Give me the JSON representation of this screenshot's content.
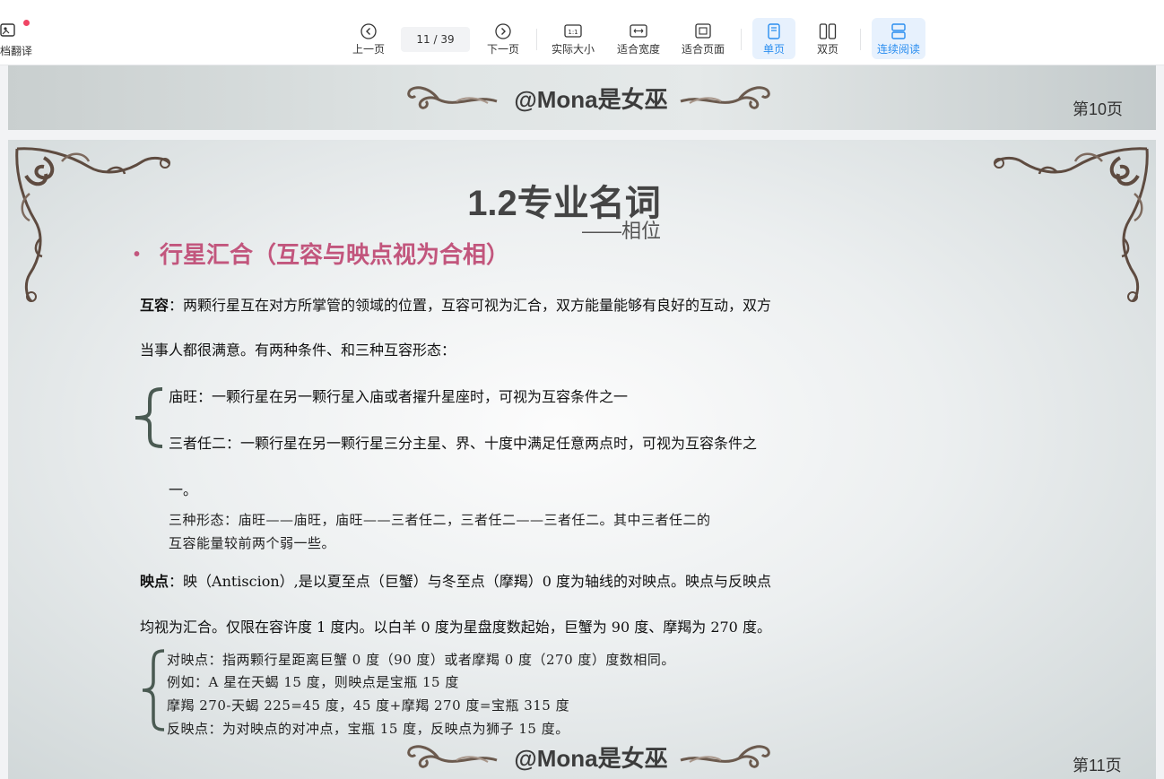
{
  "toolbar": {
    "left_label": "档翻译",
    "prev_label": "上一页",
    "page_indicator": "11 / 39",
    "next_label": "下一页",
    "actual_size_label": "实际大小",
    "fit_width_label": "适合宽度",
    "fit_page_label": "适合页面",
    "single_page_label": "单页",
    "double_page_label": "双页",
    "continuous_label": "连续阅读",
    "actual_size_icon_text": "1:1",
    "accent_color": "#2a8ef0"
  },
  "prev_page": {
    "watermark": "@Mona是女巫",
    "page_number": "第10页"
  },
  "page": {
    "title": "1.2专业名词",
    "subtitle": "——相位",
    "bullet_heading": "行星汇合（互容与映点视为合相）",
    "bullet_color": "#c2567d",
    "mutual_term": "互容",
    "mutual_def_1": "：两颗行星互在对方所掌管的领域的位置，互容可视为汇合，双方能量能够有良好的互动，双方",
    "mutual_def_2": "当事人都很满意。有两种条件、和三种互容形态：",
    "cond_1": "庙旺：一颗行星在另一颗行星入庙或者擢升星座时，可视为互容条件之一",
    "cond_2a": "三者任二：一颗行星在另一颗行星三分主星、界、十度中满足任意两点时，可视为互容条件之",
    "cond_2b": "一。",
    "forms_1": "三种形态：庙旺——庙旺，庙旺——三者任二，三者任二——三者任二。其中三者任二的",
    "forms_2": "互容能量较前两个弱一些。",
    "antiscion_term": "映点",
    "antiscion_def_1": "：映（Antiscion）,是以夏至点（巨蟹）与冬至点（摩羯）0 度为轴线的对映点。映点与反映点",
    "antiscion_def_2": "均视为汇合。仅限在容许度 1 度内。以白羊 0 度为星盘度数起始，巨蟹为 90 度、摩羯为 270 度。",
    "anti_1": "对映点：指两颗行星距离巨蟹 0 度（90 度）或者摩羯 0 度（270 度）度数相同。",
    "anti_2": "例如：A 星在天蝎 15 度，则映点是宝瓶 15 度",
    "anti_3": "摩羯 270-天蝎 225=45 度，45 度+摩羯 270 度=宝瓶 315 度",
    "anti_4": "反映点：为对映点的对冲点，宝瓶 15 度，反映点为狮子 15 度。",
    "watermark": "@Mona是女巫",
    "page_number": "第11页"
  }
}
